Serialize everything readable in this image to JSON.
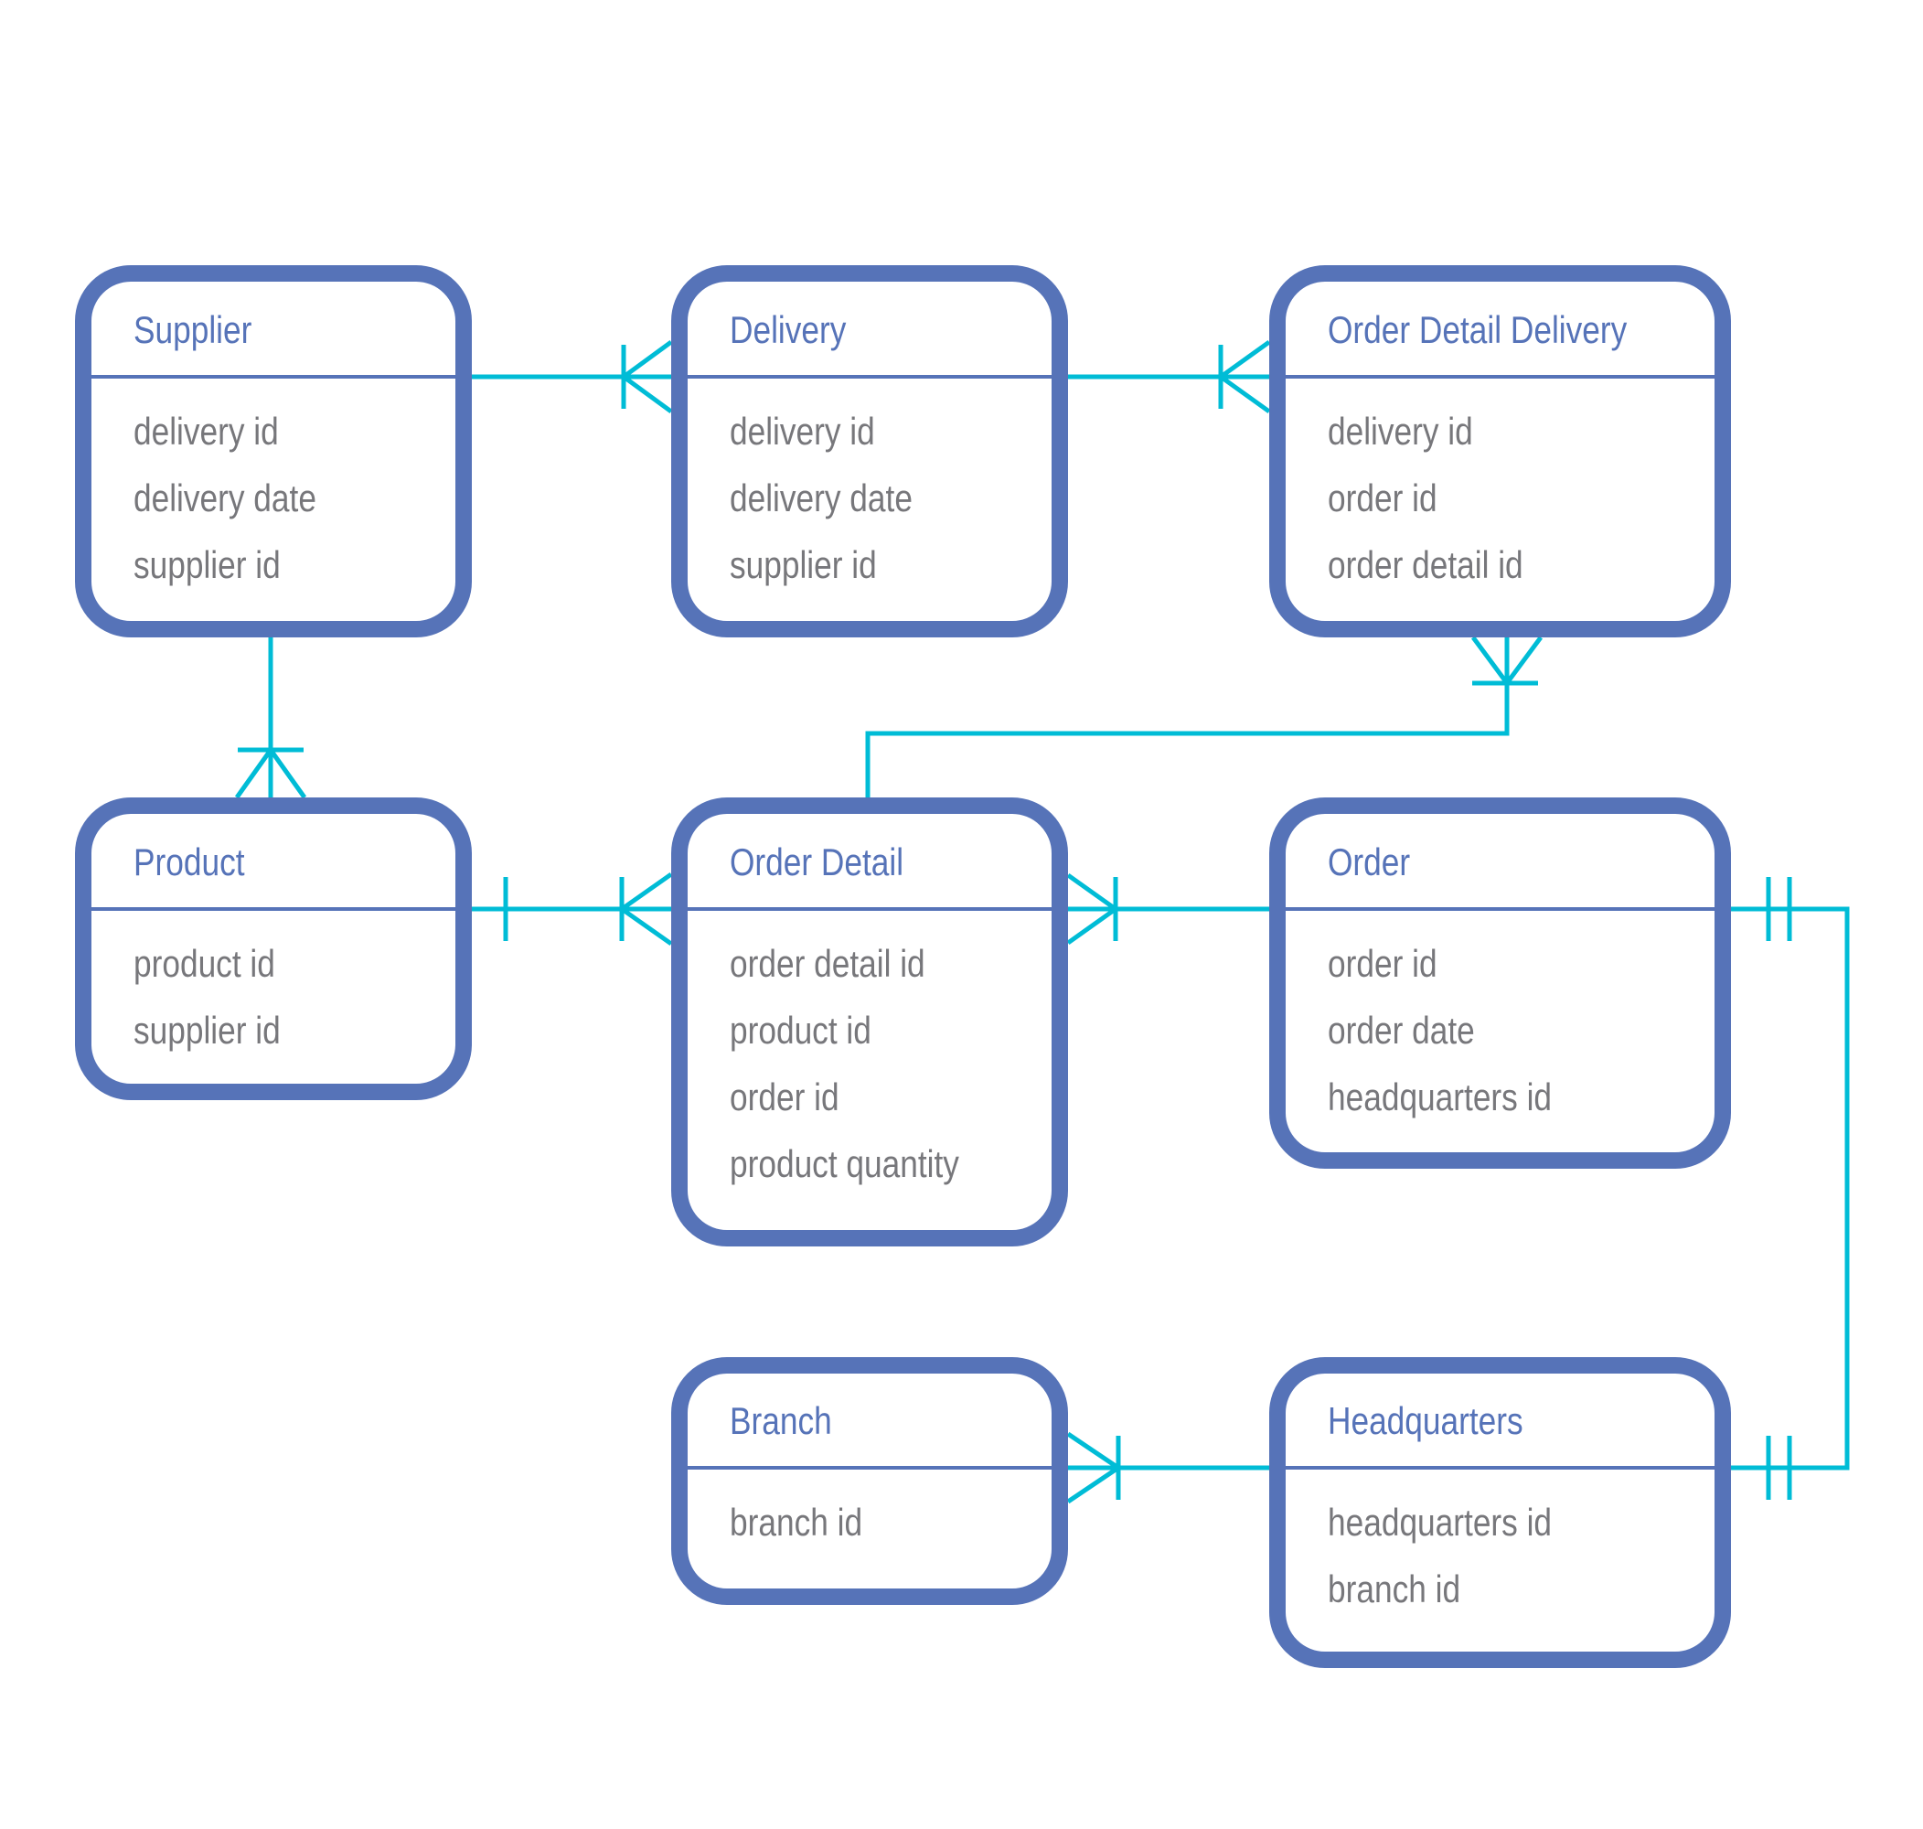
{
  "diagram": {
    "type": "entity-relationship",
    "notation": "crow's foot",
    "colors": {
      "entity_border": "#5673B8",
      "entity_title": "#5673B8",
      "attribute_text": "#77777B",
      "relationship_line": "#00BCD6",
      "background": "#FFFFFF"
    },
    "entities": [
      {
        "id": "supplier",
        "title": "Supplier",
        "attributes": [
          "delivery id",
          "delivery date",
          "supplier id"
        ]
      },
      {
        "id": "delivery",
        "title": "Delivery",
        "attributes": [
          "delivery id",
          "delivery date",
          "supplier id"
        ]
      },
      {
        "id": "order_detail_delivery",
        "title": "Order Detail Delivery",
        "attributes": [
          "delivery id",
          "order id",
          "order detail id"
        ]
      },
      {
        "id": "product",
        "title": "Product",
        "attributes": [
          "product id",
          "supplier id"
        ]
      },
      {
        "id": "order_detail",
        "title": "Order Detail",
        "attributes": [
          "order detail id",
          "product id",
          "order id",
          "product quantity"
        ]
      },
      {
        "id": "order",
        "title": "Order",
        "attributes": [
          "order id",
          "order date",
          "headquarters id"
        ]
      },
      {
        "id": "branch",
        "title": "Branch",
        "attributes": [
          "branch id"
        ]
      },
      {
        "id": "headquarters",
        "title": "Headquarters",
        "attributes": [
          "headquarters id",
          "branch id"
        ]
      }
    ],
    "relationships": [
      {
        "id": "supplier-delivery",
        "from": "supplier",
        "to": "delivery",
        "from_end": "none",
        "to_end": "one-or-many"
      },
      {
        "id": "delivery-odd",
        "from": "delivery",
        "to": "order_detail_delivery",
        "from_end": "none",
        "to_end": "one-or-many"
      },
      {
        "id": "supplier-product",
        "from": "supplier",
        "to": "product",
        "from_end": "none",
        "to_end": "one-or-many"
      },
      {
        "id": "order_detail-odd",
        "from": "order_detail",
        "to": "order_detail_delivery",
        "from_end": "none",
        "to_end": "one-or-many"
      },
      {
        "id": "product-order_detail",
        "from": "product",
        "to": "order_detail",
        "from_end": "one",
        "to_end": "one-or-many"
      },
      {
        "id": "order_detail-order",
        "from": "order_detail",
        "to": "order",
        "from_end": "one-or-many",
        "to_end": "none"
      },
      {
        "id": "order-headquarters",
        "from": "order",
        "to": "headquarters",
        "from_end": "one-and-only-one",
        "to_end": "one-and-only-one"
      },
      {
        "id": "branch-headquarters",
        "from": "branch",
        "to": "headquarters",
        "from_end": "one-or-many",
        "to_end": "none"
      }
    ]
  }
}
